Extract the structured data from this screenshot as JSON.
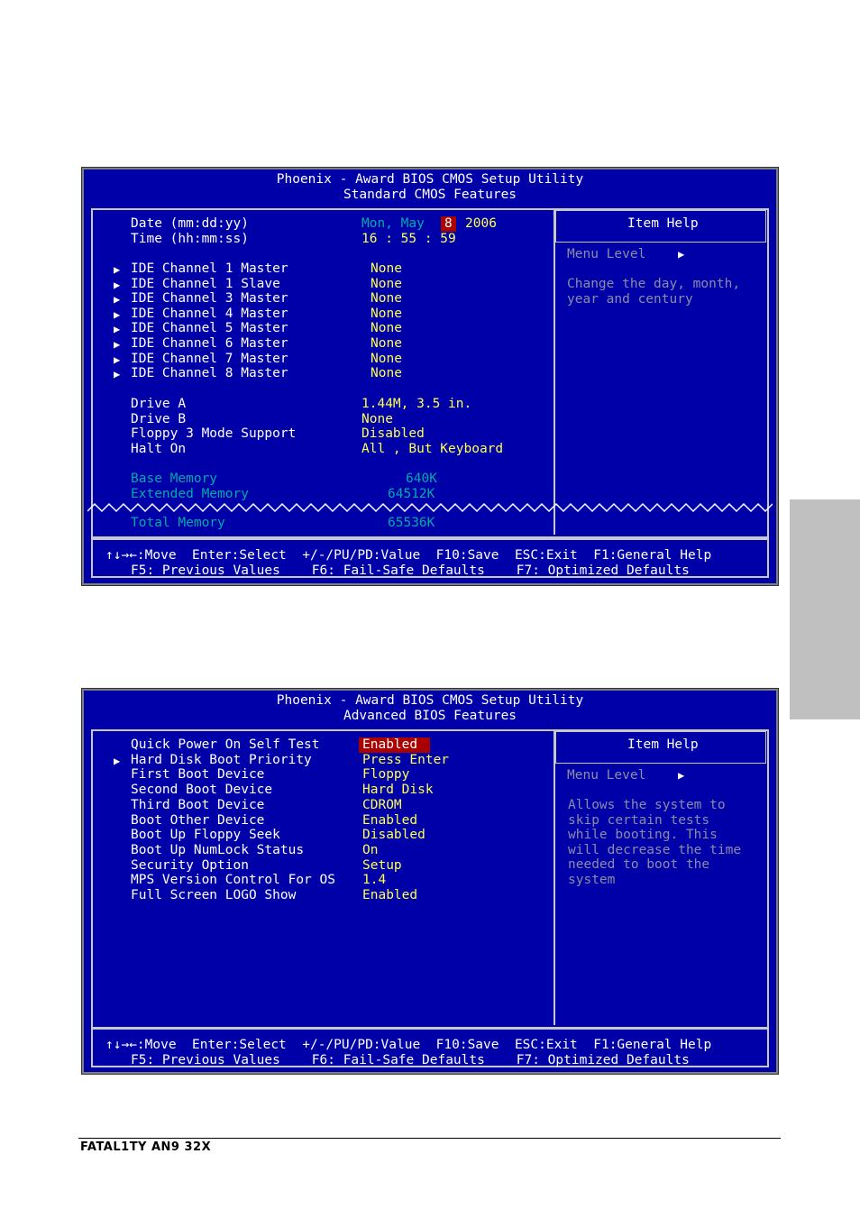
{
  "screen1": {
    "title1": "Phoenix - Award BIOS CMOS Setup Utility",
    "title2": "Standard CMOS Features",
    "date_label": "Date (mm:dd:yy)",
    "time_label": "Time (hh:mm:ss)",
    "date_day": "Mon, May",
    "date_sel": "8",
    "date_year": "2006",
    "time_value": "16 : 55 : 59",
    "ide": [
      {
        "label": "IDE Channel 1 Master",
        "value": "None"
      },
      {
        "label": "IDE Channel 1 Slave",
        "value": "None"
      },
      {
        "label": "IDE Channel 3 Master",
        "value": "None"
      },
      {
        "label": "IDE Channel 4 Master",
        "value": "None"
      },
      {
        "label": "IDE Channel 5 Master",
        "value": "None"
      },
      {
        "label": "IDE Channel 6 Master",
        "value": "None"
      },
      {
        "label": "IDE Channel 7 Master",
        "value": "None"
      },
      {
        "label": "IDE Channel 8 Master",
        "value": "None"
      }
    ],
    "drive_a_label": "Drive A",
    "drive_a_value": "1.44M, 3.5 in.",
    "drive_b_label": "Drive B",
    "drive_b_value": "None",
    "floppy3_label": "Floppy 3 Mode Support",
    "floppy3_value": "Disabled",
    "halt_label": "Halt On",
    "halt_value": "All , But Keyboard",
    "base_mem_label": "Base Memory",
    "base_mem_value": "640K",
    "ext_mem_label": "Extended Memory",
    "ext_mem_value": "64512K",
    "total_mem_label": "Total Memory",
    "total_mem_value": "65536K",
    "help_title": "Item Help",
    "menu_level": "Menu Level",
    "help_line1": "Change the day, month,",
    "help_line2": "year and century",
    "footer1": "↑↓→←:Move  Enter:Select  +/-/PU/PD:Value  F10:Save  ESC:Exit  F1:General Help",
    "footer2": "F5: Previous Values    F6: Fail-Safe Defaults    F7: Optimized Defaults"
  },
  "screen2": {
    "title1": "Phoenix - Award BIOS CMOS Setup Utility",
    "title2": "Advanced BIOS Features",
    "items": [
      {
        "label": "Quick Power On Self Test",
        "value": "Enabled"
      },
      {
        "label": "Hard Disk Boot Priority",
        "value": "Press Enter"
      },
      {
        "label": "First Boot Device",
        "value": "Floppy"
      },
      {
        "label": "Second Boot Device",
        "value": "Hard Disk"
      },
      {
        "label": "Third Boot Device",
        "value": "CDROM"
      },
      {
        "label": "Boot Other Device",
        "value": "Enabled"
      },
      {
        "label": "Boot Up Floppy Seek",
        "value": "Disabled"
      },
      {
        "label": "Boot Up NumLock Status",
        "value": "On"
      },
      {
        "label": "Security Option",
        "value": "Setup"
      },
      {
        "label": "MPS Version Control For OS",
        "value": "1.4"
      },
      {
        "label": "Full Screen LOGO Show",
        "value": "Enabled"
      }
    ],
    "help_title": "Item Help",
    "menu_level": "Menu Level",
    "help_lines": [
      "Allows the system to",
      "skip certain tests",
      "while booting. This",
      "will decrease the time",
      "needed to boot the",
      "system"
    ],
    "footer1": "↑↓→←:Move  Enter:Select  +/-/PU/PD:Value  F10:Save  ESC:Exit  F1:General Help",
    "footer2": "F5: Previous Values    F6: Fail-Safe Defaults    F7: Optimized Defaults"
  },
  "footer": {
    "brand": "FATAL1TY AN9 32X"
  }
}
